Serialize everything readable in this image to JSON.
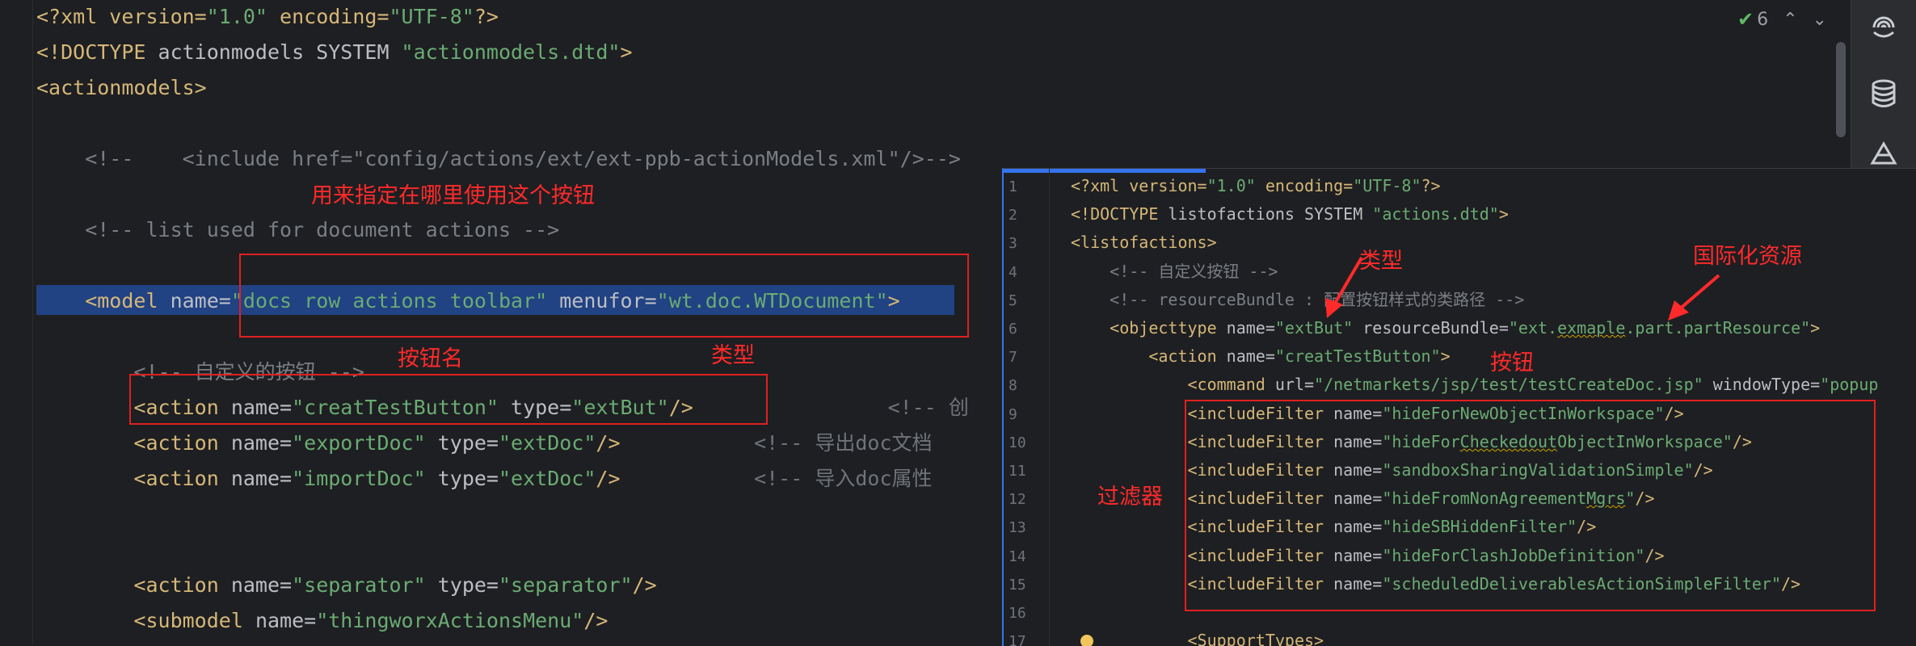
{
  "editor": {
    "lines": [
      {
        "segments": [
          [
            "pi",
            "<?xml version="
          ],
          [
            "val",
            "\"1.0\""
          ],
          [
            "pi",
            " encoding="
          ],
          [
            "val",
            "\"UTF-8\""
          ],
          [
            "pi",
            "?>"
          ]
        ]
      },
      {
        "segments": [
          [
            "tag",
            "<!DOCTYPE "
          ],
          [
            "attr",
            "actionmodels SYSTEM "
          ],
          [
            "val",
            "\"actionmodels.dtd\""
          ],
          [
            "tag",
            ">"
          ]
        ]
      },
      {
        "segments": [
          [
            "tag",
            "<actionmodels>"
          ]
        ]
      },
      {
        "segments": []
      },
      {
        "segments": [
          [
            "com",
            "    <!--    <include href=\"config/actions/ext/ext-ppb-actionModels.xml\"/>-->"
          ]
        ]
      },
      {
        "segments": []
      },
      {
        "segments": [
          [
            "com",
            "    <!-- list used for document actions -->"
          ]
        ]
      },
      {
        "segments": []
      },
      {
        "segments": [
          [
            "tag",
            "    <model "
          ],
          [
            "attr",
            "name="
          ],
          [
            "val",
            "\"docs row actions toolbar\""
          ],
          [
            "attr",
            " menufor="
          ],
          [
            "val",
            "\"wt.doc.WTDocument\""
          ],
          [
            "tag",
            ">"
          ]
        ]
      },
      {
        "segments": []
      },
      {
        "segments": [
          [
            "com",
            "        <!-- 自定义的按钮 -->"
          ]
        ]
      },
      {
        "segments": [
          [
            "tag",
            "        <action "
          ],
          [
            "attr",
            "name="
          ],
          [
            "val",
            "\"creatTestButton\""
          ],
          [
            "attr",
            " type="
          ],
          [
            "val",
            "\"extBut\""
          ],
          [
            "tag",
            "/>"
          ],
          [
            "hint",
            "                <!-- 创"
          ]
        ]
      },
      {
        "segments": [
          [
            "tag",
            "        <action "
          ],
          [
            "attr",
            "name="
          ],
          [
            "val",
            "\"exportDoc\""
          ],
          [
            "attr",
            " type="
          ],
          [
            "val",
            "\"extDoc\""
          ],
          [
            "tag",
            "/>"
          ],
          [
            "hint",
            "           <!-- 导出doc文档"
          ]
        ]
      },
      {
        "segments": [
          [
            "tag",
            "        <action "
          ],
          [
            "attr",
            "name="
          ],
          [
            "val",
            "\"importDoc\""
          ],
          [
            "attr",
            " type="
          ],
          [
            "val",
            "\"extDoc\""
          ],
          [
            "tag",
            "/>"
          ],
          [
            "hint",
            "           <!-- 导入doc属性"
          ]
        ]
      },
      {
        "segments": []
      },
      {
        "segments": []
      },
      {
        "segments": [
          [
            "tag",
            "        <action "
          ],
          [
            "attr",
            "name="
          ],
          [
            "val",
            "\"separator\""
          ],
          [
            "attr",
            " type="
          ],
          [
            "val",
            "\"separator\""
          ],
          [
            "tag",
            "/>"
          ]
        ]
      },
      {
        "segments": [
          [
            "tag",
            "        <submodel "
          ],
          [
            "attr",
            "name="
          ],
          [
            "val",
            "\"thingworxActionsMenu\""
          ],
          [
            "tag",
            "/>"
          ]
        ]
      }
    ]
  },
  "annotations": {
    "where_used": "用来指定在哪里使用这个按钮",
    "button_name": "按钮名",
    "type_left": "类型",
    "type_right": "类型",
    "i18n_resource": "国际化资源",
    "button_right": "按钮",
    "filter": "过滤器"
  },
  "inspection": {
    "count": "6",
    "check_icon": "check-icon",
    "up_icon": "chevron-up-icon",
    "down_icon": "chevron-down-icon"
  },
  "toolbar": {
    "icons": [
      "ai-assistant-icon",
      "database-icon",
      "gradle-icon"
    ]
  },
  "popup": {
    "line_numbers": [
      "1",
      "2",
      "3",
      "4",
      "5",
      "6",
      "7",
      "8",
      "9",
      "10",
      "11",
      "12",
      "13",
      "14",
      "15",
      "16",
      "17"
    ],
    "lines": [
      {
        "segments": [
          [
            "pi",
            "<?xml version="
          ],
          [
            "val",
            "\"1.0\""
          ],
          [
            "pi",
            " encoding="
          ],
          [
            "val",
            "\"UTF-8\""
          ],
          [
            "pi",
            "?>"
          ]
        ]
      },
      {
        "segments": [
          [
            "tag",
            "<!DOCTYPE "
          ],
          [
            "attr",
            "listofactions SYSTEM "
          ],
          [
            "val",
            "\"actions.dtd\""
          ],
          [
            "tag",
            ">"
          ]
        ]
      },
      {
        "segments": [
          [
            "tag",
            "<listofactions>"
          ]
        ]
      },
      {
        "segments": [
          [
            "com",
            "    <!-- 自定义按钮 -->"
          ]
        ]
      },
      {
        "segments": [
          [
            "com",
            "    <!-- resourceBundle : 配置按钮样式的类路径 -->"
          ]
        ]
      },
      {
        "segments": [
          [
            "tag",
            "    <objecttype "
          ],
          [
            "attr",
            "name="
          ],
          [
            "val",
            "\"extBut\""
          ],
          [
            "attr",
            " resourceBundle="
          ],
          [
            "val",
            "\"ext."
          ],
          [
            "valw",
            "exmaple"
          ],
          [
            "val",
            ".part.partResource\""
          ],
          [
            "tag",
            ">"
          ]
        ]
      },
      {
        "segments": [
          [
            "tag",
            "        <action "
          ],
          [
            "attr",
            "name="
          ],
          [
            "val",
            "\"creatTestButton\""
          ],
          [
            "tag",
            ">"
          ]
        ]
      },
      {
        "segments": [
          [
            "tag",
            "            <command "
          ],
          [
            "attr",
            "url="
          ],
          [
            "val",
            "\"/netmarkets/jsp/test/testCreateDoc.jsp\""
          ],
          [
            "attr",
            " windowType="
          ],
          [
            "val",
            "\"popup"
          ]
        ]
      },
      {
        "segments": [
          [
            "tag",
            "            <includeFilter "
          ],
          [
            "attr",
            "name="
          ],
          [
            "val",
            "\"hideForNewObjectInWorkspace\""
          ],
          [
            "tag",
            "/>"
          ]
        ]
      },
      {
        "segments": [
          [
            "tag",
            "            <includeFilter "
          ],
          [
            "attr",
            "name="
          ],
          [
            "val",
            "\"hideFor"
          ],
          [
            "valw",
            "Checkedout"
          ],
          [
            "val",
            "ObjectInWorkspace\""
          ],
          [
            "tag",
            "/>"
          ]
        ]
      },
      {
        "segments": [
          [
            "tag",
            "            <includeFilter "
          ],
          [
            "attr",
            "name="
          ],
          [
            "val",
            "\"sandboxSharingValidationSimple\""
          ],
          [
            "tag",
            "/>"
          ]
        ]
      },
      {
        "segments": [
          [
            "tag",
            "            <includeFilter "
          ],
          [
            "attr",
            "name="
          ],
          [
            "val",
            "\"hideFromNonAgreement"
          ],
          [
            "valw",
            "Mgrs"
          ],
          [
            "val",
            "\""
          ],
          [
            "tag",
            "/>"
          ]
        ]
      },
      {
        "segments": [
          [
            "tag",
            "            <includeFilter "
          ],
          [
            "attr",
            "name="
          ],
          [
            "val",
            "\"hideSBHiddenFilter\""
          ],
          [
            "tag",
            "/>"
          ]
        ]
      },
      {
        "segments": [
          [
            "tag",
            "            <includeFilter "
          ],
          [
            "attr",
            "name="
          ],
          [
            "val",
            "\"hideForClashJobDefinition\""
          ],
          [
            "tag",
            "/>"
          ]
        ]
      },
      {
        "segments": [
          [
            "tag",
            "            <includeFilter "
          ],
          [
            "attr",
            "name="
          ],
          [
            "val",
            "\"scheduledDeliverablesActionSimpleFilter\""
          ],
          [
            "tag",
            "/>"
          ]
        ]
      },
      {
        "segments": []
      },
      {
        "segments": [
          [
            "tag",
            "            <SupportTypes>"
          ]
        ]
      }
    ]
  }
}
